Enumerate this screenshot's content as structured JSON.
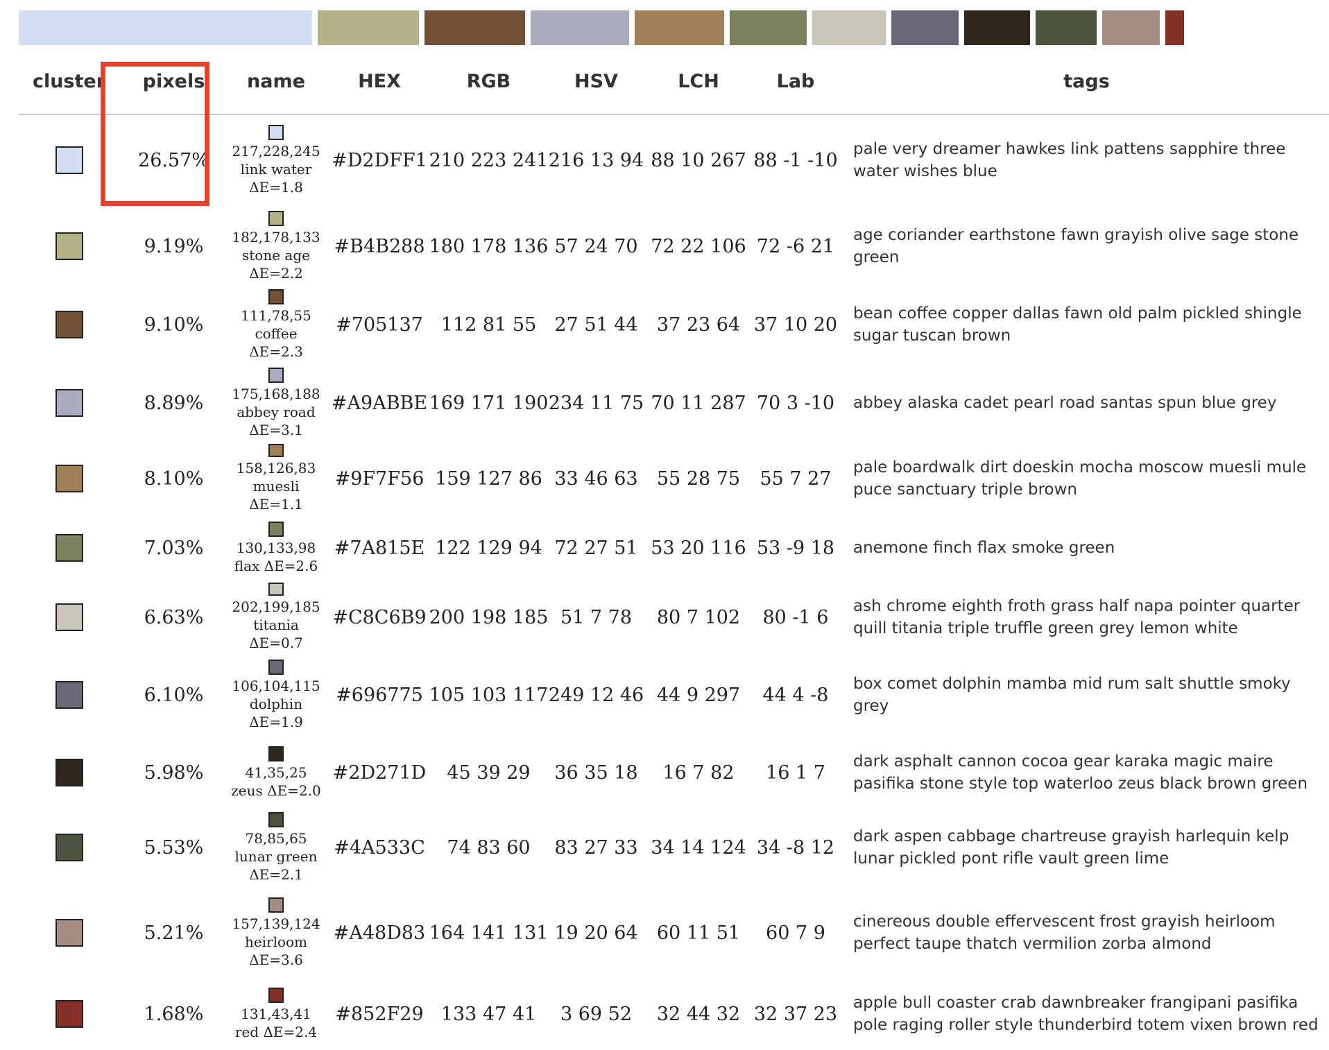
{
  "palette_bar": [
    {
      "color": "#D2DFF1",
      "share": 26.57
    },
    {
      "color": "#B4B288",
      "share": 9.19
    },
    {
      "color": "#705137",
      "share": 9.1
    },
    {
      "color": "#A9ABBE",
      "share": 8.89
    },
    {
      "color": "#9F7F56",
      "share": 8.1
    },
    {
      "color": "#7A815E",
      "share": 7.03
    },
    {
      "color": "#C8C6B9",
      "share": 6.63
    },
    {
      "color": "#696775",
      "share": 6.1
    },
    {
      "color": "#2D271D",
      "share": 5.98
    },
    {
      "color": "#4A533C",
      "share": 5.53
    },
    {
      "color": "#A48D83",
      "share": 5.21
    },
    {
      "color": "#852F29",
      "share": 1.68
    }
  ],
  "headers": {
    "cluster": "cluster",
    "pixels": "pixels",
    "name": "name",
    "hex": "HEX",
    "rgb": "RGB",
    "hsv": "HSV",
    "lch": "LCH",
    "lab": "Lab",
    "tags": "tags"
  },
  "highlight_color": "#E5412E",
  "rows": [
    {
      "color": "#D2DFF1",
      "pixels": "26.57%",
      "name_rgb": "217,228,245",
      "name": "link water",
      "name_de": "ΔE=1.8",
      "hex": "#D2DFF1",
      "rgb": "210 223 241",
      "hsv": "216 13 94",
      "lch": "88 10 267",
      "lab": "88 -1 -10",
      "tags": "pale very dreamer hawkes link pattens sapphire three water wishes blue"
    },
    {
      "color": "#B4B288",
      "pixels": "9.19%",
      "name_rgb": "182,178,133",
      "name": "stone age",
      "name_de": "ΔE=2.2",
      "hex": "#B4B288",
      "rgb": "180 178 136",
      "hsv": "57 24 70",
      "lch": "72 22 106",
      "lab": "72 -6 21",
      "tags": "age coriander earthstone fawn grayish olive sage stone green"
    },
    {
      "color": "#705137",
      "pixels": "9.10%",
      "name_rgb": "111,78,55",
      "name": "coffee ΔE=2.3",
      "name_de": "",
      "hex": "#705137",
      "rgb": "112 81 55",
      "hsv": "27 51 44",
      "lch": "37 23 64",
      "lab": "37 10 20",
      "tags": "bean coffee copper dallas fawn old palm pickled shingle sugar tuscan brown"
    },
    {
      "color": "#A9ABBE",
      "pixels": "8.89%",
      "name_rgb": "175,168,188",
      "name": "abbey road",
      "name_de": "ΔE=3.1",
      "hex": "#A9ABBE",
      "rgb": "169 171 190",
      "hsv": "234 11 75",
      "lch": "70 11 287",
      "lab": "70 3 -10",
      "tags": "abbey alaska cadet pearl road santas spun blue grey"
    },
    {
      "color": "#9F7F56",
      "pixels": "8.10%",
      "name_rgb": "158,126,83",
      "name": "muesli ΔE=1.1",
      "name_de": "",
      "hex": "#9F7F56",
      "rgb": "159 127 86",
      "hsv": "33 46 63",
      "lch": "55 28 75",
      "lab": "55 7 27",
      "tags": "pale boardwalk dirt doeskin mocha moscow muesli mule puce sanctuary triple brown"
    },
    {
      "color": "#7A815E",
      "pixels": "7.03%",
      "name_rgb": "130,133,98",
      "name": "flax ΔE=2.6",
      "name_de": "",
      "hex": "#7A815E",
      "rgb": "122 129 94",
      "hsv": "72 27 51",
      "lch": "53 20 116",
      "lab": "53 -9 18",
      "tags": "anemone finch flax smoke green"
    },
    {
      "color": "#C8C6B9",
      "pixels": "6.63%",
      "name_rgb": "202,199,185",
      "name": "titania ΔE=0.7",
      "name_de": "",
      "hex": "#C8C6B9",
      "rgb": "200 198 185",
      "hsv": "51 7 78",
      "lch": "80 7 102",
      "lab": "80 -1 6",
      "tags": "ash chrome eighth froth grass half napa pointer quarter quill titania triple truffle green grey lemon white"
    },
    {
      "color": "#696775",
      "pixels": "6.10%",
      "name_rgb": "106,104,115",
      "name": "dolphin",
      "name_de": "ΔE=1.9",
      "hex": "#696775",
      "rgb": "105 103 117",
      "hsv": "249 12 46",
      "lch": "44 9 297",
      "lab": "44 4 -8",
      "tags": "box comet dolphin mamba mid rum salt shuttle smoky grey"
    },
    {
      "color": "#2D271D",
      "pixels": "5.98%",
      "name_rgb": "41,35,25",
      "name": "zeus ΔE=2.0",
      "name_de": "",
      "hex": "#2D271D",
      "rgb": "45 39 29",
      "hsv": "36 35 18",
      "lch": "16 7 82",
      "lab": "16 1 7",
      "tags": "dark asphalt cannon cocoa gear karaka magic maire pasifika stone style top waterloo zeus black brown green"
    },
    {
      "color": "#4A533C",
      "pixels": "5.53%",
      "name_rgb": "78,85,65",
      "name": "lunar green",
      "name_de": "ΔE=2.1",
      "hex": "#4A533C",
      "rgb": "74 83 60",
      "hsv": "83 27 33",
      "lch": "34 14 124",
      "lab": "34 -8 12",
      "tags": "dark aspen cabbage chartreuse grayish harlequin kelp lunar pickled pont rifle vault green lime"
    },
    {
      "color": "#A48D83",
      "pixels": "5.21%",
      "name_rgb": "157,139,124",
      "name": "heirloom",
      "name_de": "ΔE=3.6",
      "hex": "#A48D83",
      "rgb": "164 141 131",
      "hsv": "19 20 64",
      "lch": "60 11 51",
      "lab": "60 7 9",
      "tags": "cinereous double effervescent frost grayish heirloom perfect taupe thatch vermilion zorba almond"
    },
    {
      "color": "#852F29",
      "pixels": "1.68%",
      "name_rgb": "131,43,41",
      "name": "red ΔE=2.4",
      "name_de": "",
      "hex": "#852F29",
      "rgb": "133 47 41",
      "hsv": "3 69 52",
      "lch": "32 44 32",
      "lab": "32 37 23",
      "tags": "apple bull coaster crab dawnbreaker frangipani pasifika pole raging roller style thunderbird totem vixen brown red"
    }
  ]
}
